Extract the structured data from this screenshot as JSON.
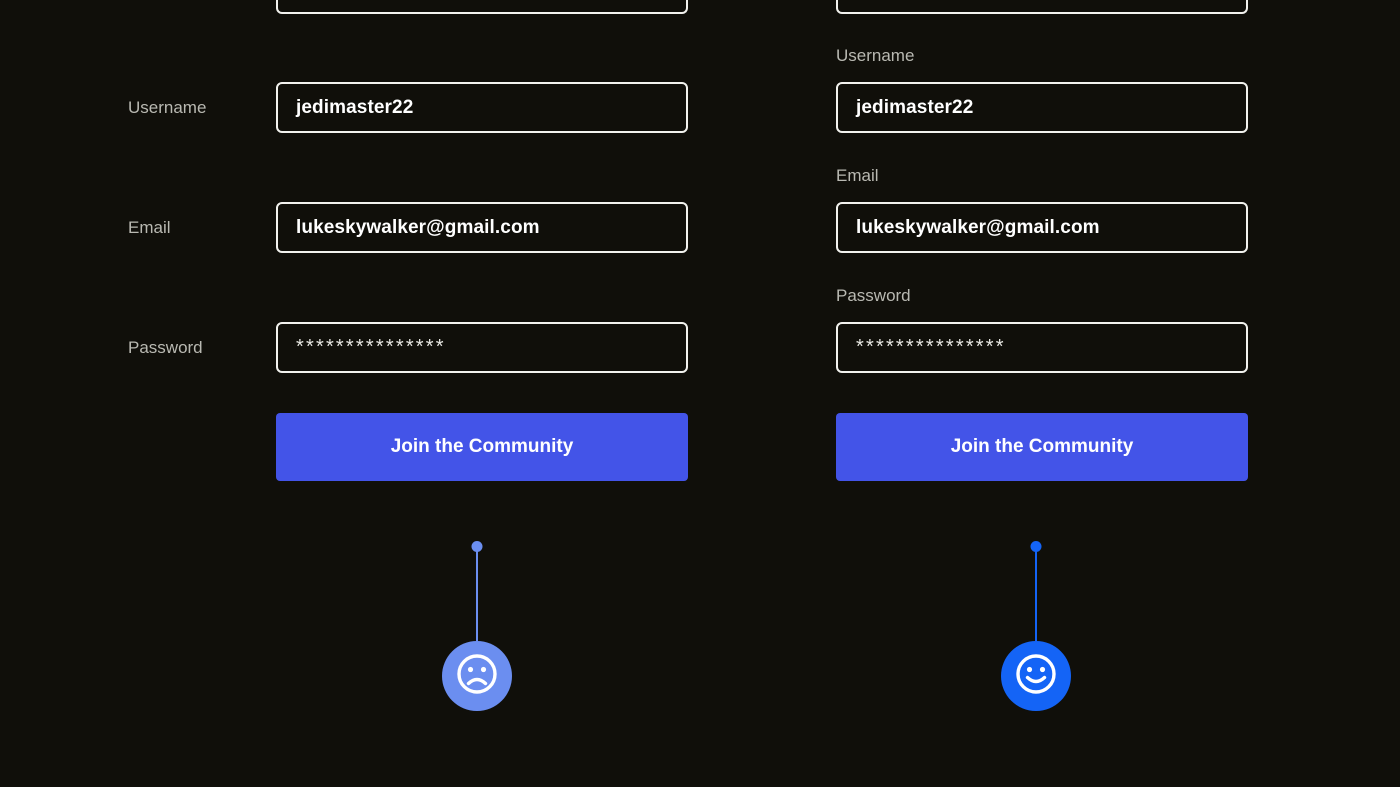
{
  "theme": {
    "background": "#100f0a",
    "field_border": "#f2f2ee",
    "field_text": "#ffffff",
    "label_text": "#b9b9b2",
    "cta_background": "#4354e8",
    "cta_text": "#ffffff",
    "marker_sad_color": "#6b8ef0",
    "marker_happy_color": "#1464f6"
  },
  "variants": [
    {
      "id": "left-variant",
      "layout": "label-left",
      "fields": [
        {
          "name": "username",
          "label": "Username",
          "value": "jedimaster22",
          "masked": false
        },
        {
          "name": "email",
          "label": "Email",
          "value": "lukeskywalker@gmail.com",
          "masked": false
        },
        {
          "name": "password",
          "label": "Password",
          "value": "***************",
          "masked": true
        }
      ],
      "cta": {
        "label": "Join the Community"
      },
      "marker": {
        "icon": "frowning-face-icon",
        "sentiment": "negative"
      }
    },
    {
      "id": "right-variant",
      "layout": "label-top",
      "fields": [
        {
          "name": "username",
          "label": "Username",
          "value": "jedimaster22",
          "masked": false
        },
        {
          "name": "email",
          "label": "Email",
          "value": "lukeskywalker@gmail.com",
          "masked": false
        },
        {
          "name": "password",
          "label": "Password",
          "value": "***************",
          "masked": true
        }
      ],
      "cta": {
        "label": "Join the Community"
      },
      "marker": {
        "icon": "smiling-face-icon",
        "sentiment": "positive"
      }
    }
  ]
}
